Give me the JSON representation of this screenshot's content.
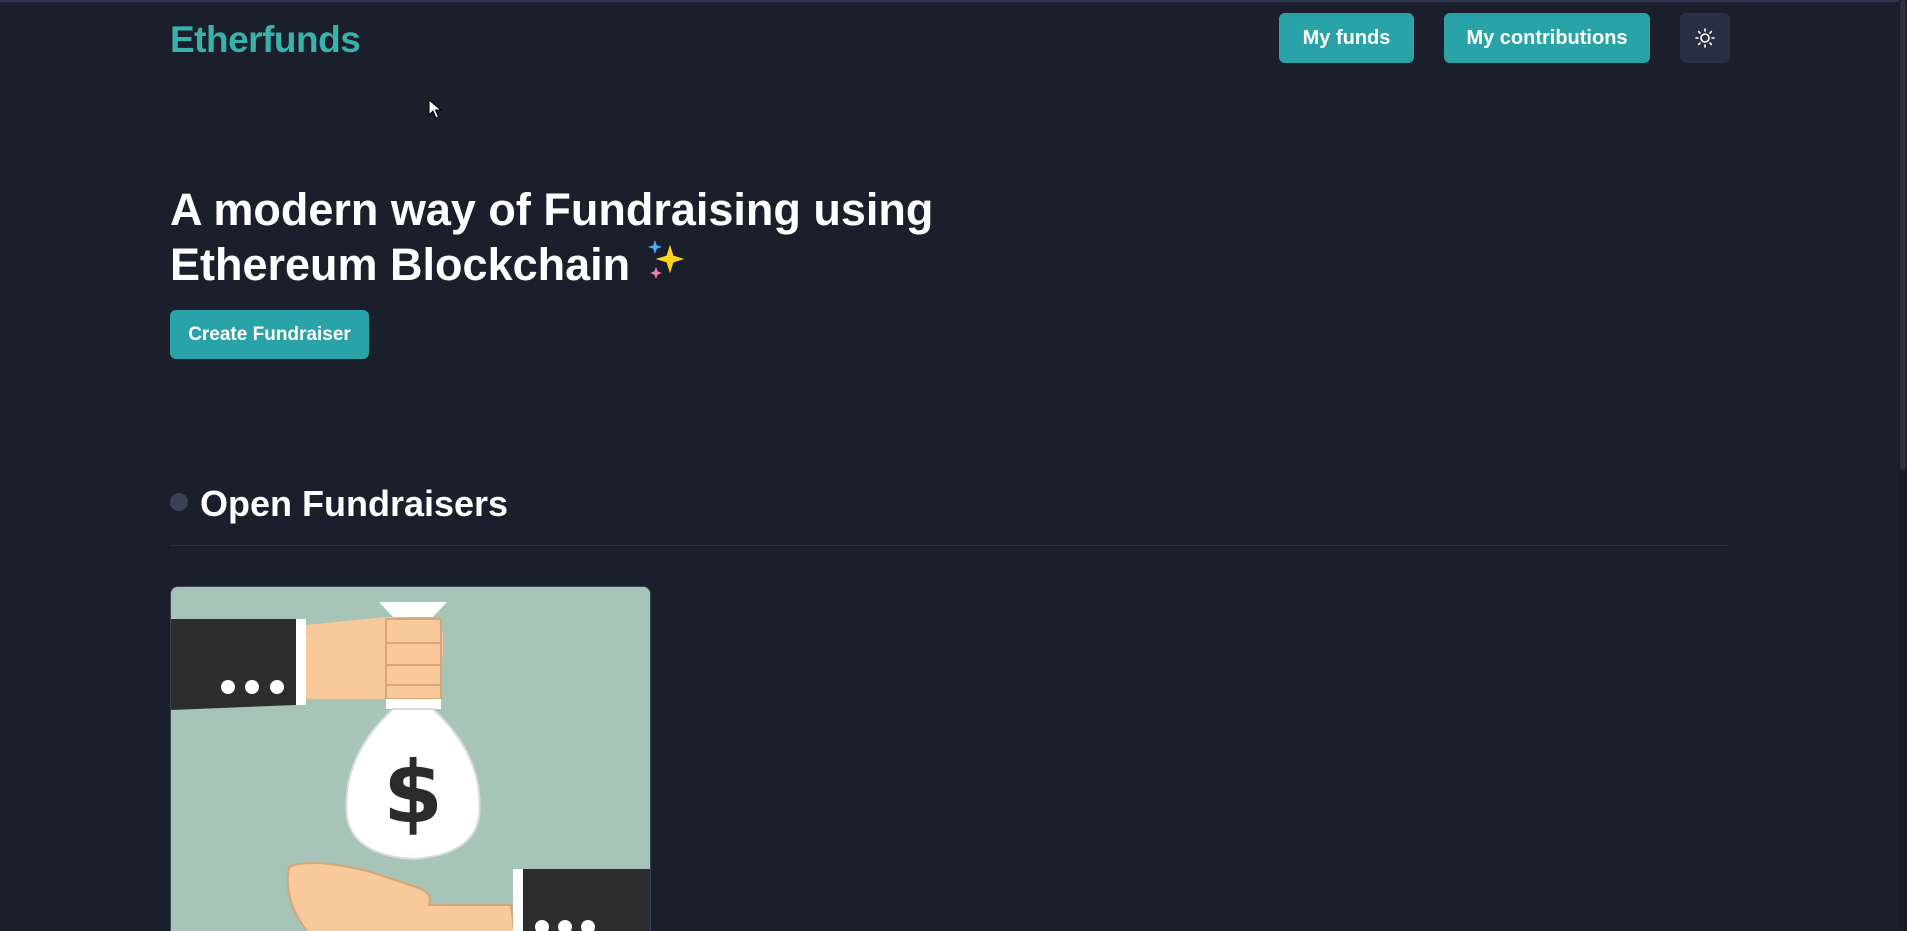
{
  "header": {
    "logo": "Etherfunds",
    "my_funds_label": "My funds",
    "my_contributions_label": "My contributions",
    "theme_icon": "sun-icon"
  },
  "hero": {
    "title_line1": "A modern way of Fundraising using",
    "title_line2": "Ethereum Blockchain",
    "sparkle_icon": "sparkles-icon",
    "create_button_label": "Create Fundraiser"
  },
  "open_fundraisers": {
    "heading": "Open Fundraisers",
    "cards": [
      {
        "image": "money-bag-handover-illustration"
      }
    ]
  },
  "colors": {
    "background": "#1b1f2b",
    "accent": "#2aa3a8",
    "logo": "#38b2ac",
    "card_bg": "#a6c4b7"
  }
}
